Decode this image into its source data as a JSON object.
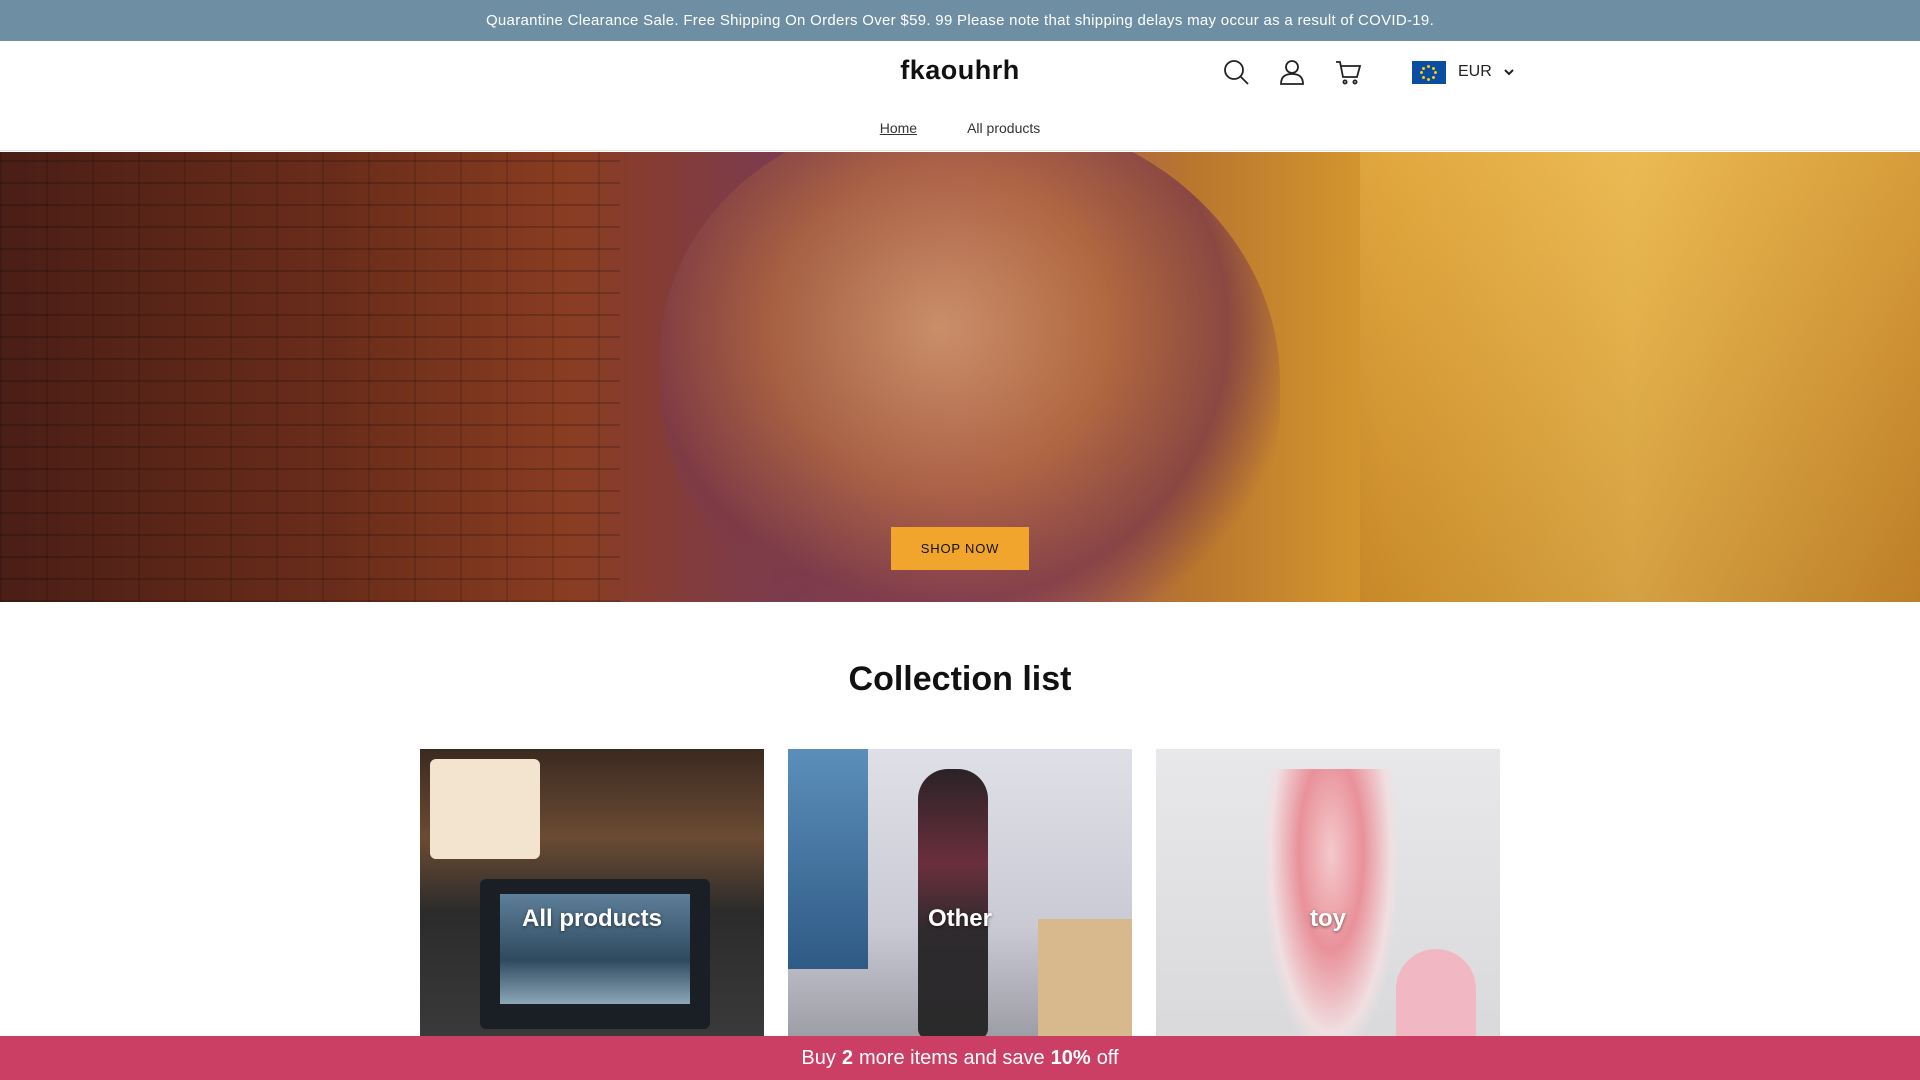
{
  "announcement": {
    "text": "Quarantine Clearance Sale. Free Shipping On Orders Over $59. 99 Please note that shipping delays may occur as a result of COVID-19."
  },
  "header": {
    "logo": "fkaouhrh",
    "icons": [
      "search-icon",
      "account-icon",
      "cart-icon"
    ],
    "currency": {
      "flag": "eu-flag-icon",
      "code": "EUR"
    }
  },
  "nav": {
    "items": [
      {
        "label": "Home",
        "active": true
      },
      {
        "label": "All products",
        "active": false
      }
    ]
  },
  "hero": {
    "cta": "SHOP NOW",
    "cta_color": "#f2a52d"
  },
  "collections": {
    "title": "Collection list",
    "items": [
      {
        "title": "All products"
      },
      {
        "title": "Other"
      },
      {
        "title": "toy"
      }
    ]
  },
  "promo": {
    "prefix": "Buy",
    "count": "2",
    "middle": "more items and save",
    "discount": "10%",
    "suffix": "off",
    "color": "#cc3f64"
  },
  "colors": {
    "announcement_bg": "#6e8fa3",
    "promo_bg": "#cc3f64",
    "accent": "#f2a52d"
  }
}
